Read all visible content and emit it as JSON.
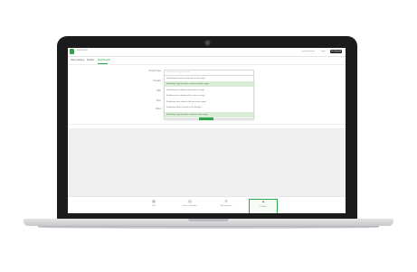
{
  "app": {
    "topbar_title": "Data Model",
    "topbar_links": [
      "Documentation",
      "Help"
    ],
    "topbar_button": "Get Started"
  },
  "tabs": [
    "Data Catalog",
    "Models",
    "Dashboards"
  ],
  "form": {
    "labels": [
      "Prepaid Type",
      "Forecast",
      "Date",
      "Price",
      "Notes"
    ],
    "select_placeholder": "Predicting the type of order"
  },
  "dropdown": {
    "items": [
      "Predicting the trend of the price in the range",
      "Predicting: Type of orders, nearest in date range",
      "Predicting best: details of the price in range",
      "Predicting how: details of the same in range",
      "Predicting: best orders of all and in the range",
      "Predicting: future: details of the 90 days",
      "Predicting: Type of orders, nearest in the range"
    ],
    "highlighted": [
      1,
      6
    ]
  },
  "footer": {
    "items": [
      {
        "icon": "table-icon",
        "label": "Data"
      },
      {
        "icon": "chart-icon",
        "label": "Forecast Engine"
      },
      {
        "icon": "gear-icon",
        "label": "Management"
      },
      {
        "icon": "flag-icon",
        "label": "Publish"
      }
    ],
    "active": 3
  }
}
